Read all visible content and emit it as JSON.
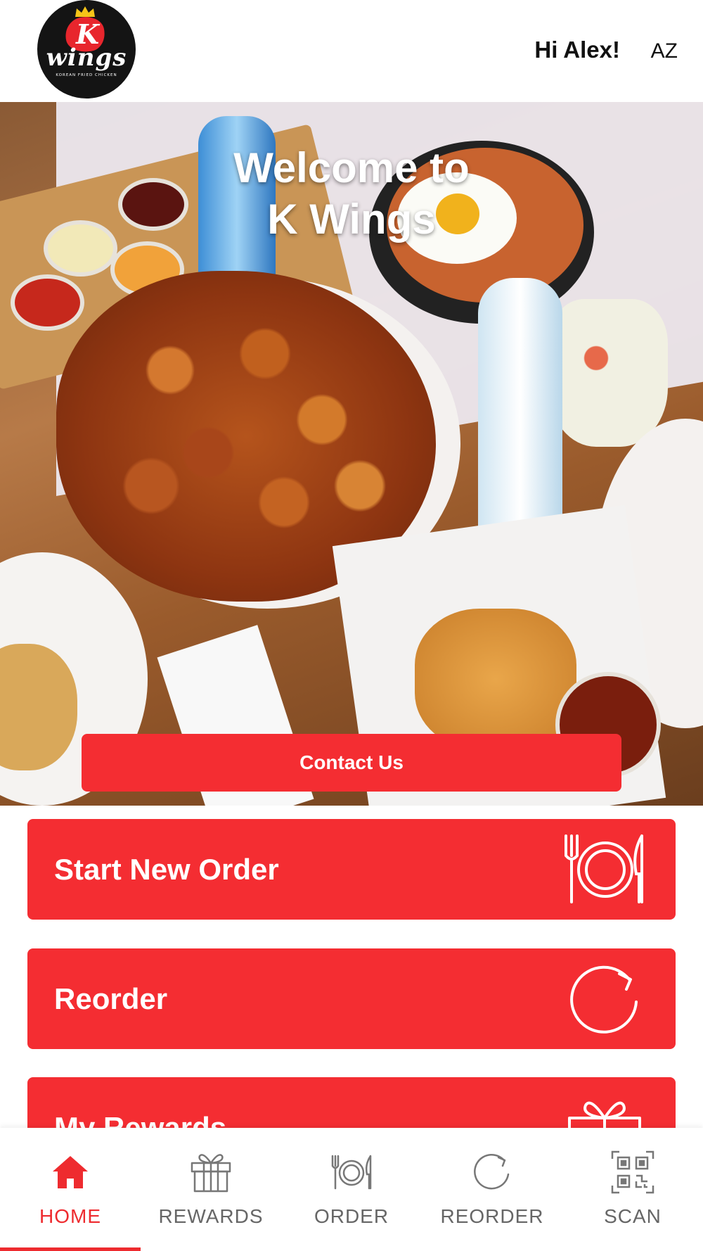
{
  "header": {
    "logo": {
      "letter": "K",
      "wordmark": "wings",
      "tagline": "KOREAN FRIED CHICKEN"
    },
    "greeting": "Hi Alex!",
    "user_initials": "AZ"
  },
  "hero": {
    "title_line1": "Welcome to",
    "title_line2": "K Wings",
    "contact_label": "Contact Us"
  },
  "actions": [
    {
      "label": "Start New Order",
      "icon": "plate-fork-knife-icon"
    },
    {
      "label": "Reorder",
      "icon": "refresh-icon"
    },
    {
      "label": "My Rewards",
      "icon": "gift-icon"
    }
  ],
  "tabs": [
    {
      "label": "HOME",
      "icon": "home-icon",
      "active": true
    },
    {
      "label": "REWARDS",
      "icon": "gift-icon",
      "active": false
    },
    {
      "label": "ORDER",
      "icon": "plate-fork-knife-icon",
      "active": false
    },
    {
      "label": "REORDER",
      "icon": "refresh-icon",
      "active": false
    },
    {
      "label": "SCAN",
      "icon": "qr-code-icon",
      "active": false
    }
  ],
  "colors": {
    "brand_red": "#f42d32",
    "active_tab": "#ee2b2f",
    "inactive_tab": "#666666"
  }
}
